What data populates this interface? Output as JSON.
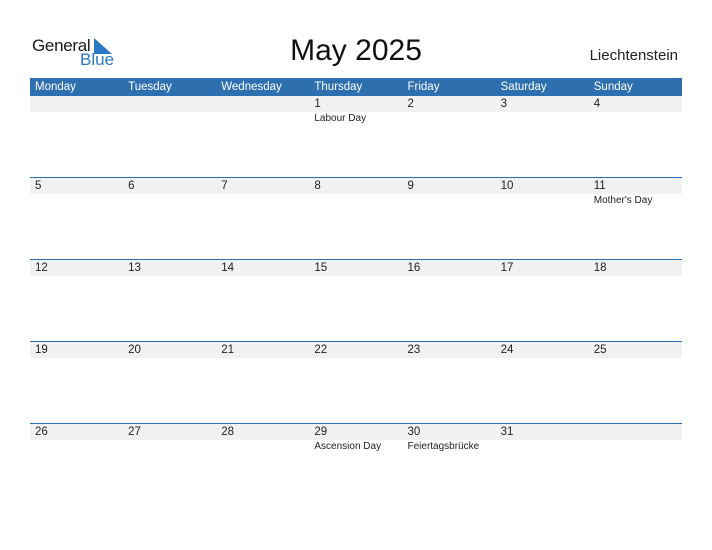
{
  "logo": {
    "line1": "General",
    "line2": "Blue"
  },
  "title": "May 2025",
  "country": "Liechtenstein",
  "weekdays": [
    "Monday",
    "Tuesday",
    "Wednesday",
    "Thursday",
    "Friday",
    "Saturday",
    "Sunday"
  ],
  "weeks": [
    [
      {
        "d": "",
        "h": ""
      },
      {
        "d": "",
        "h": ""
      },
      {
        "d": "",
        "h": ""
      },
      {
        "d": "1",
        "h": "Labour Day"
      },
      {
        "d": "2",
        "h": ""
      },
      {
        "d": "3",
        "h": ""
      },
      {
        "d": "4",
        "h": ""
      }
    ],
    [
      {
        "d": "5",
        "h": ""
      },
      {
        "d": "6",
        "h": ""
      },
      {
        "d": "7",
        "h": ""
      },
      {
        "d": "8",
        "h": ""
      },
      {
        "d": "9",
        "h": ""
      },
      {
        "d": "10",
        "h": ""
      },
      {
        "d": "11",
        "h": "Mother's Day"
      }
    ],
    [
      {
        "d": "12",
        "h": ""
      },
      {
        "d": "13",
        "h": ""
      },
      {
        "d": "14",
        "h": ""
      },
      {
        "d": "15",
        "h": ""
      },
      {
        "d": "16",
        "h": ""
      },
      {
        "d": "17",
        "h": ""
      },
      {
        "d": "18",
        "h": ""
      }
    ],
    [
      {
        "d": "19",
        "h": ""
      },
      {
        "d": "20",
        "h": ""
      },
      {
        "d": "21",
        "h": ""
      },
      {
        "d": "22",
        "h": ""
      },
      {
        "d": "23",
        "h": ""
      },
      {
        "d": "24",
        "h": ""
      },
      {
        "d": "25",
        "h": ""
      }
    ],
    [
      {
        "d": "26",
        "h": ""
      },
      {
        "d": "27",
        "h": ""
      },
      {
        "d": "28",
        "h": ""
      },
      {
        "d": "29",
        "h": "Ascension Day"
      },
      {
        "d": "30",
        "h": "Feiertagsbrücke"
      },
      {
        "d": "31",
        "h": ""
      },
      {
        "d": "",
        "h": ""
      }
    ]
  ]
}
